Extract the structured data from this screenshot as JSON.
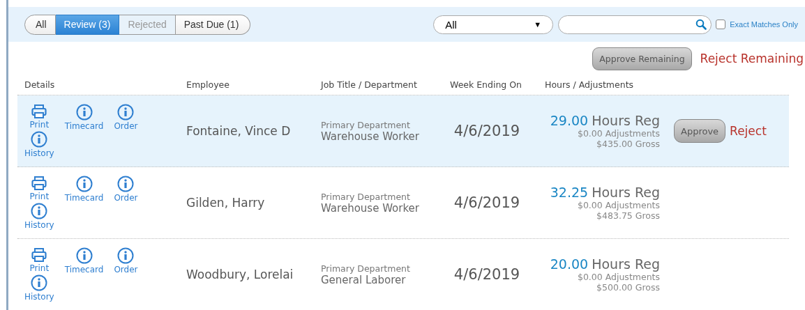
{
  "filter_tabs": [
    {
      "label": "All",
      "selected": false,
      "disabled": false
    },
    {
      "label": "Review (3)",
      "selected": true,
      "disabled": false
    },
    {
      "label": "Rejected",
      "selected": false,
      "disabled": true
    },
    {
      "label": "Past Due (1)",
      "selected": false,
      "disabled": false
    }
  ],
  "filter_dropdown": {
    "value": "All",
    "caret": "▼"
  },
  "exact_matches": {
    "label": "Exact Matches Only",
    "checked": false
  },
  "bulk_actions": {
    "approve": "Approve Remaining",
    "reject": "Reject Remaining"
  },
  "table": {
    "columns": [
      "Details",
      "Employee",
      "Job Title / Department",
      "Week Ending On",
      "Hours / Adjustments"
    ],
    "rows": [
      {
        "selected": true,
        "links": [
          "Print",
          "Timecard",
          "Order",
          "History"
        ],
        "employee": "Fontaine, Vince D",
        "department": "Primary Department",
        "job_title": "Warehouse Worker",
        "week_ending": "4/6/2019",
        "hours": "29.00",
        "hours_label": "Hours Reg",
        "adjustments": "$0.00 Adjustments",
        "gross": "$435.00 Gross",
        "actions": {
          "approve": "Approve",
          "reject": "Reject"
        }
      },
      {
        "selected": false,
        "links": [
          "Print",
          "Timecard",
          "Order",
          "History"
        ],
        "employee": "Gilden, Harry",
        "department": "Primary Department",
        "job_title": "Warehouse Worker",
        "week_ending": "4/6/2019",
        "hours": "32.25",
        "hours_label": "Hours Reg",
        "adjustments": "$0.00 Adjustments",
        "gross": "$483.75 Gross"
      },
      {
        "selected": false,
        "links": [
          "Print",
          "Timecard",
          "Order",
          "History"
        ],
        "employee": "Woodbury, Lorelai",
        "department": "Primary Department",
        "job_title": "General Laborer",
        "week_ending": "4/6/2019",
        "hours": "20.00",
        "hours_label": "Hours Reg",
        "adjustments": "$0.00 Adjustments",
        "gross": "$500.00 Gross"
      }
    ]
  }
}
